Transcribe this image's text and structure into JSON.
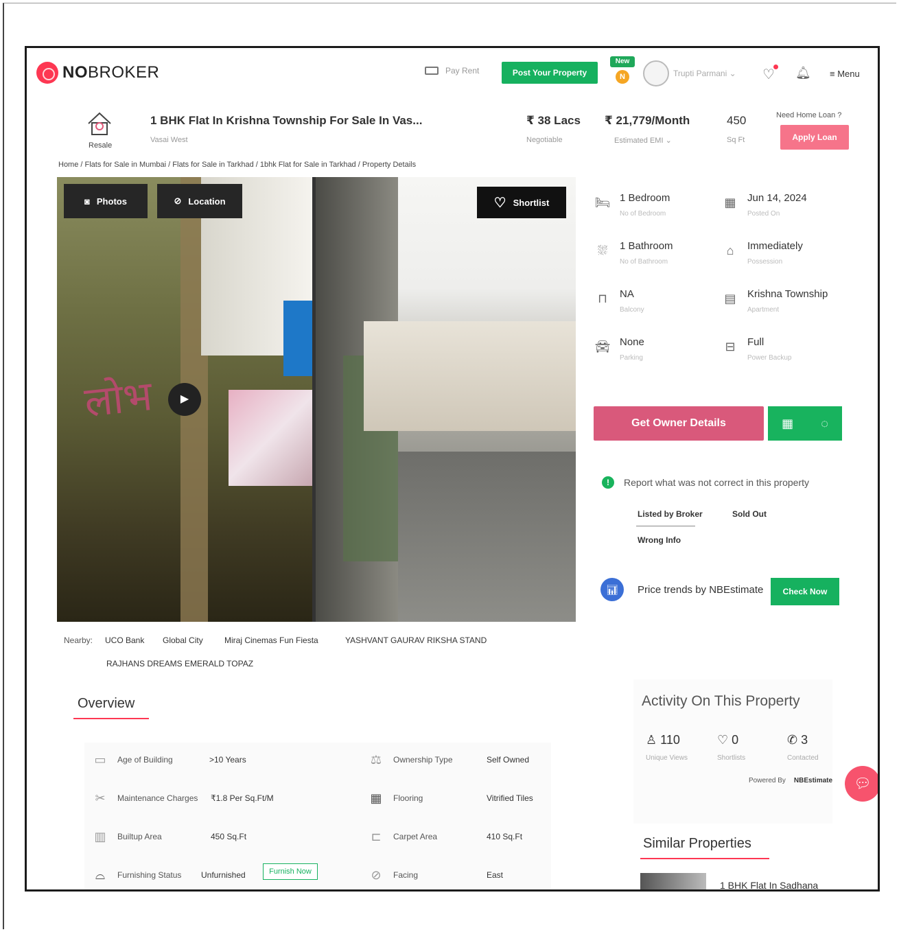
{
  "brand": {
    "name_bold": "NO",
    "name_rest": "BROKER",
    "accent": "#fd3752"
  },
  "header": {
    "pay_rent": "Pay Rent",
    "post_property": "Post Your Property",
    "new_badge": "New",
    "new_initial": "N",
    "user_name": "Trupti Parmani",
    "menu": "Menu"
  },
  "listing": {
    "type_label": "Resale",
    "title": "1 BHK Flat In Krishna Township For Sale In Vas...",
    "location": "Vasai West",
    "price": "₹ 38 Lacs",
    "price_note": "Negotiable",
    "emi": "₹ 21,779/Month",
    "emi_note": "Estimated EMI",
    "area": "450",
    "area_unit": "Sq Ft",
    "loan_prompt": "Need Home Loan ?",
    "apply_loan": "Apply Loan"
  },
  "breadcrumb": "Home / Flats for Sale in Mumbai / Flats for Sale in Tarkhad / 1bhk Flat for Sale in Tarkhad / Property Details",
  "gallery": {
    "photos": "Photos",
    "location": "Location",
    "shortlist": "Shortlist",
    "graffiti": "लोभ"
  },
  "details": [
    {
      "icon": "bed-icon",
      "value": "1 Bedroom",
      "label": "No of Bedroom"
    },
    {
      "icon": "calendar-icon",
      "value": "Jun 14, 2024",
      "label": "Posted On"
    },
    {
      "icon": "bath-icon",
      "value": "1 Bathroom",
      "label": "No of Bathroom"
    },
    {
      "icon": "possession-icon",
      "value": "Immediately",
      "label": "Possession"
    },
    {
      "icon": "balcony-icon",
      "value": "NA",
      "label": "Balcony"
    },
    {
      "icon": "apartment-icon",
      "value": "Krishna Township",
      "label": "Apartment"
    },
    {
      "icon": "car-icon",
      "value": "None",
      "label": "Parking"
    },
    {
      "icon": "power-icon",
      "value": "Full",
      "label": "Power Backup"
    }
  ],
  "actions": {
    "owner_details": "Get Owner Details"
  },
  "report": {
    "text": "Report what was not correct in this property",
    "options": [
      "Listed by Broker",
      "Sold Out",
      "Wrong Info"
    ]
  },
  "trend": {
    "text": "Price trends by NBEstimate",
    "check": "Check Now"
  },
  "nearby": {
    "label": "Nearby:",
    "places": [
      "UCO Bank",
      "Global City",
      "Miraj Cinemas Fun Fiesta",
      "YASHVANT GAURAV RIKSHA STAND",
      "RAJHANS DREAMS EMERALD TOPAZ"
    ]
  },
  "overview": {
    "title": "Overview",
    "items": [
      {
        "key": "Age of Building",
        "value": ">10 Years"
      },
      {
        "key": "Ownership Type",
        "value": "Self Owned"
      },
      {
        "key": "Maintenance Charges",
        "value": "₹1.8 Per Sq.Ft/M"
      },
      {
        "key": "Flooring",
        "value": "Vitrified Tiles"
      },
      {
        "key": "Builtup Area",
        "value": "450 Sq.Ft"
      },
      {
        "key": "Carpet Area",
        "value": "410 Sq.Ft"
      },
      {
        "key": "Furnishing Status",
        "value": "Unfurnished"
      },
      {
        "key": "Facing",
        "value": "East"
      }
    ],
    "furnish_now": "Furnish Now"
  },
  "activity": {
    "title": "Activity On This Property",
    "stats": [
      {
        "value": "110",
        "label": "Unique Views"
      },
      {
        "value": "0",
        "label": "Shortlists"
      },
      {
        "value": "3",
        "label": "Contacted"
      }
    ],
    "powered_by": "Powered By",
    "powered_name": "NBEstimate"
  },
  "similar": {
    "title": "Similar Properties",
    "first_item": "1 BHK Flat In Sadhana"
  }
}
